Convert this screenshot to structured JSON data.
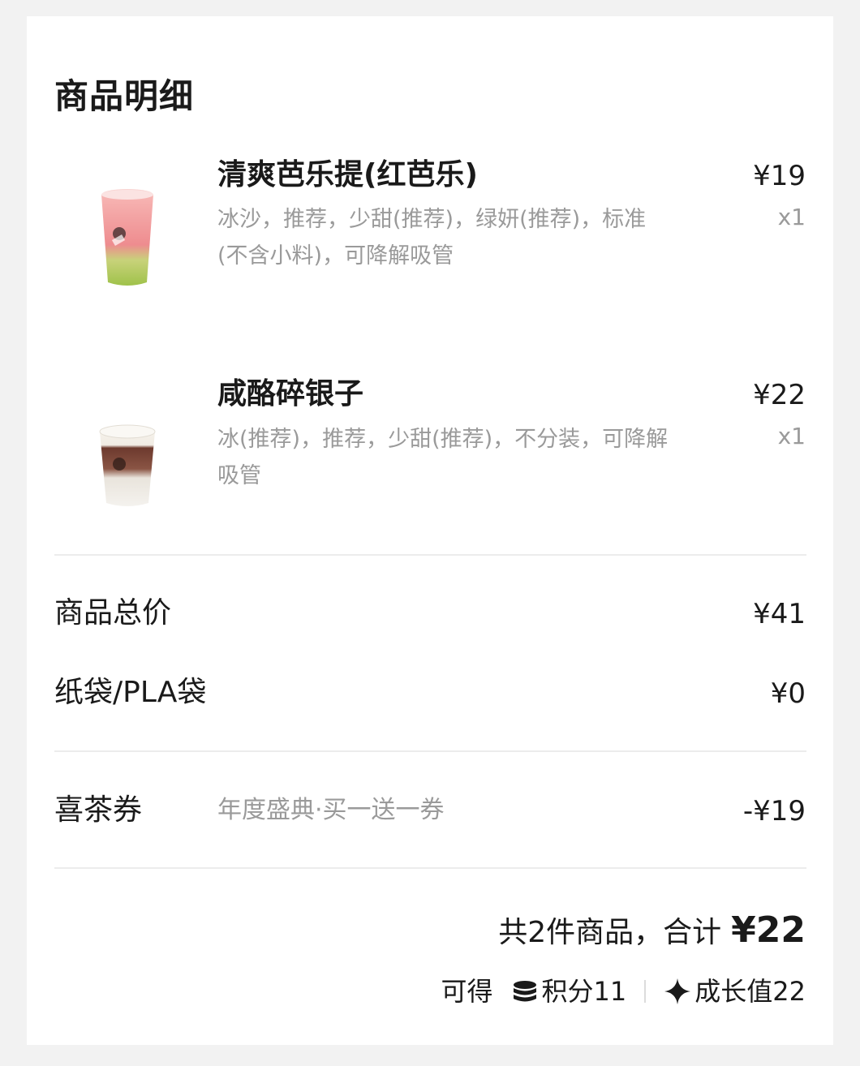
{
  "section_title": "商品明细",
  "items": [
    {
      "name": "清爽芭乐提(红芭乐)",
      "options": "冰沙，推荐，少甜(推荐)，绿妍(推荐)，标准(不含小料)，可降解吸管",
      "price": "¥19",
      "qty": "x1",
      "image_icon": "pink-green-drink-cup"
    },
    {
      "name": "咸酪碎银子",
      "options": "冰(推荐)，推荐，少甜(推荐)，不分装，可降解吸管",
      "price": "¥22",
      "qty": "x1",
      "image_icon": "brown-white-drink-cup"
    }
  ],
  "subtotal": {
    "label": "商品总价",
    "value": "¥41"
  },
  "bag": {
    "label": "纸袋/PLA袋",
    "value": "¥0"
  },
  "coupon": {
    "label": "喜茶券",
    "note": "年度盛典·买一送一券",
    "value": "-¥19"
  },
  "total": {
    "text": "共2件商品，合计",
    "amount": "¥22"
  },
  "rewards": {
    "prefix": "可得",
    "points": "积分11",
    "points_icon": "coin-stack-icon",
    "growth": "成长值22",
    "growth_icon": "sparkle-star-icon"
  }
}
